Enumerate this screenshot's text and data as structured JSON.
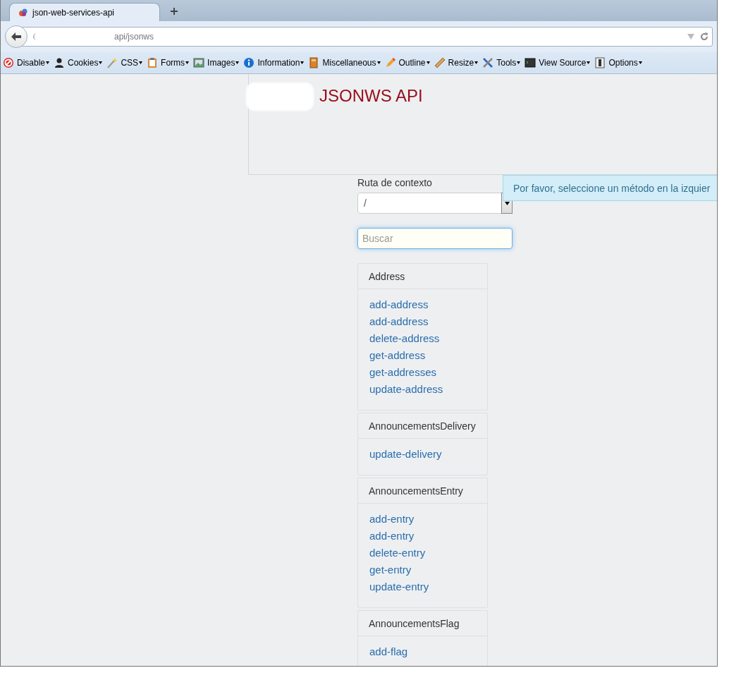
{
  "tab": {
    "title": "json-web-services-api",
    "selected": true
  },
  "address_bar": {
    "url": "api/jsonws"
  },
  "toolbar": [
    {
      "label": "Disable",
      "kind": "stop"
    },
    {
      "label": "Cookies",
      "kind": "person"
    },
    {
      "label": "CSS",
      "kind": "wand"
    },
    {
      "label": "Forms",
      "kind": "clipboard"
    },
    {
      "label": "Images",
      "kind": "image"
    },
    {
      "label": "Information",
      "kind": "info"
    },
    {
      "label": "Miscellaneous",
      "kind": "book"
    },
    {
      "label": "Outline",
      "kind": "pencil"
    },
    {
      "label": "Resize",
      "kind": "ruler"
    },
    {
      "label": "Tools",
      "kind": "tools"
    },
    {
      "label": "View Source",
      "kind": "terminal"
    },
    {
      "label": "Options",
      "kind": "options"
    }
  ],
  "header": {
    "title": "JSONWS API"
  },
  "context": {
    "label": "Ruta de contexto",
    "value": "/"
  },
  "search": {
    "placeholder": "Buscar"
  },
  "alert": {
    "text": "Por favor, seleccione un método en la izquier"
  },
  "groups": [
    {
      "name": "Address",
      "methods": [
        "add-address",
        "add-address",
        "delete-address",
        "get-address",
        "get-addresses",
        "update-address"
      ]
    },
    {
      "name": "AnnouncementsDelivery",
      "methods": [
        "update-delivery"
      ]
    },
    {
      "name": "AnnouncementsEntry",
      "methods": [
        "add-entry",
        "add-entry",
        "delete-entry",
        "get-entry",
        "update-entry"
      ]
    },
    {
      "name": "AnnouncementsFlag",
      "methods": [
        "add-flag"
      ]
    }
  ]
}
